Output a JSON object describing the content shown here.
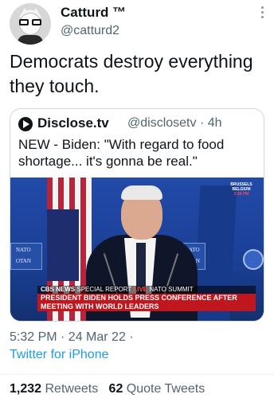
{
  "author": {
    "name": "Catturd ™",
    "handle": "@catturd2"
  },
  "tweet": {
    "text": "Democrats destroy everything they touch."
  },
  "quoted": {
    "name": "Disclose.tv",
    "handle": "@disclosetv · 4h",
    "text": "NEW - Biden: \"With regard to food shortage... it's gonna be real.\"",
    "video": {
      "bug_line1": "BRUSSELS",
      "bug_line2": "BELGIUM",
      "bug_time": "3:39 PM",
      "nato_left": "NATO",
      "nato_left2": "OTAN",
      "nato_right": "NATO",
      "nato_right2": "OTAN",
      "ticker_network": "CBS NEWS",
      "ticker_report": "SPECIAL REPORT",
      "ticker_live": "LIVE",
      "ticker_event": "NATO SUMMIT",
      "headline_line1": "PRESIDENT BIDEN HOLDS PRESS CONFERENCE AFTER",
      "headline_line2": "MEETING WITH WORLD LEADERS"
    }
  },
  "meta": {
    "timestamp": "5:32 PM · 24 Mar 22 ·",
    "source": "Twitter for iPhone"
  },
  "stats": {
    "retweets_count": "1,232",
    "retweets_label": "Retweets",
    "quotes_count": "62",
    "quotes_label": "Quote Tweets"
  },
  "colors": {
    "link": "#1d9bf0",
    "secondary_text": "#536471",
    "headline_red": "#c0171f"
  }
}
